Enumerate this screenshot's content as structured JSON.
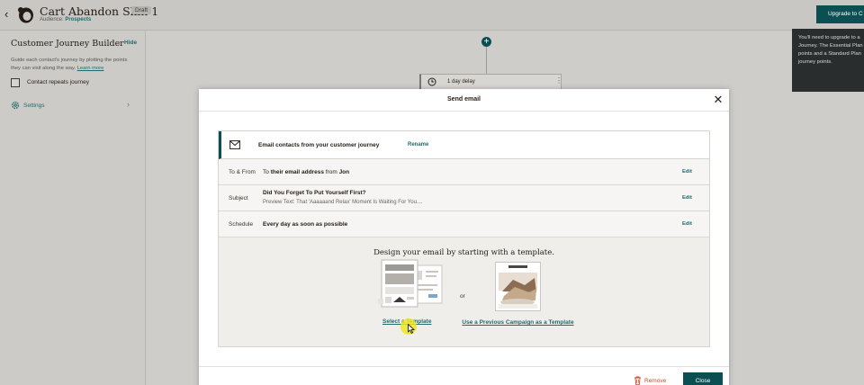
{
  "header": {
    "title": "Cart Abandon Skin 1",
    "badge": "Draft",
    "audience_label": "Audience:",
    "audience_value": "Prospects",
    "upgrade_button": "Upgrade to C",
    "tooltip": "You'll need to upgrade to a Journey. The Essential Plan points and a Standard Plan journey points."
  },
  "sidebar": {
    "title": "Customer Journey Builder",
    "hide": "Hide",
    "description": "Guide each contact's journey by plotting the points they can visit along the way.",
    "learn_more": "Learn more",
    "checkbox_label": "Contact repeats journey",
    "settings": "Settings"
  },
  "canvas": {
    "delay_label": "1 day delay"
  },
  "modal": {
    "title": "Send email",
    "email_label": "Email contacts from your customer journey",
    "rename": "Rename",
    "rows": {
      "to_from": {
        "label": "To & From",
        "prefix": "To",
        "recipient": "their email address",
        "middle": "from",
        "sender": "Jon",
        "edit": "Edit"
      },
      "subject": {
        "label": "Subject",
        "value": "Did You Forget To Put Yourself First?",
        "preview": "Preview Text: That 'Aaaaaand Relax' Moment Is Waiting For You....",
        "edit": "Edit"
      },
      "schedule": {
        "label": "Schedule",
        "value": "Every day as soon as possible",
        "edit": "Edit"
      }
    },
    "design_heading": "Design your email by starting with a template.",
    "or": "or",
    "select_template": "Select a Template",
    "previous_campaign": "Use a Previous Campaign as a Template",
    "remove": "Remove",
    "close": "Close"
  },
  "colors": {
    "accent": "#0c4f53",
    "link": "#1e6b6f",
    "danger": "#c84c2c",
    "cursor_highlight": "#f0e61e"
  },
  "icons": [
    "back-arrow-icon",
    "mailchimp-logo-icon",
    "settings-gear-icon",
    "plus-icon",
    "clock-icon",
    "more-vertical-icon",
    "close-icon",
    "mail-icon",
    "trash-icon",
    "cursor-icon"
  ]
}
